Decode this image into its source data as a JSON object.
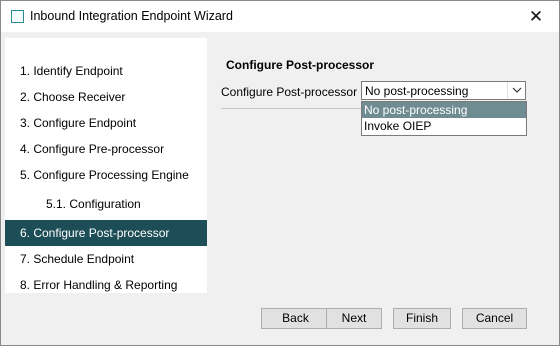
{
  "window": {
    "title": "Inbound Integration Endpoint Wizard",
    "close_glyph": "✕"
  },
  "steps": [
    {
      "label": "1. Identify Endpoint"
    },
    {
      "label": "2. Choose Receiver"
    },
    {
      "label": "3. Configure Endpoint"
    },
    {
      "label": "4. Configure Pre-processor"
    },
    {
      "label": "5. Configure Processing Engine"
    },
    {
      "label": "5.1. Configuration"
    },
    {
      "label": "6. Configure Post-processor",
      "active": true
    },
    {
      "label": "7. Schedule Endpoint"
    },
    {
      "label": "8. Error Handling & Reporting"
    }
  ],
  "content": {
    "heading": "Configure Post-processor",
    "field_label": "Configure Post-processor",
    "select": {
      "value": "No post-processing",
      "options": [
        "No post-processing",
        "Invoke OIEP"
      ],
      "expanded": true
    }
  },
  "buttons": {
    "back": "Back",
    "next": "Next",
    "finish": "Finish",
    "cancel": "Cancel"
  },
  "colors": {
    "active_step": "#1d4e57",
    "selected_option": "#6f8c93"
  }
}
